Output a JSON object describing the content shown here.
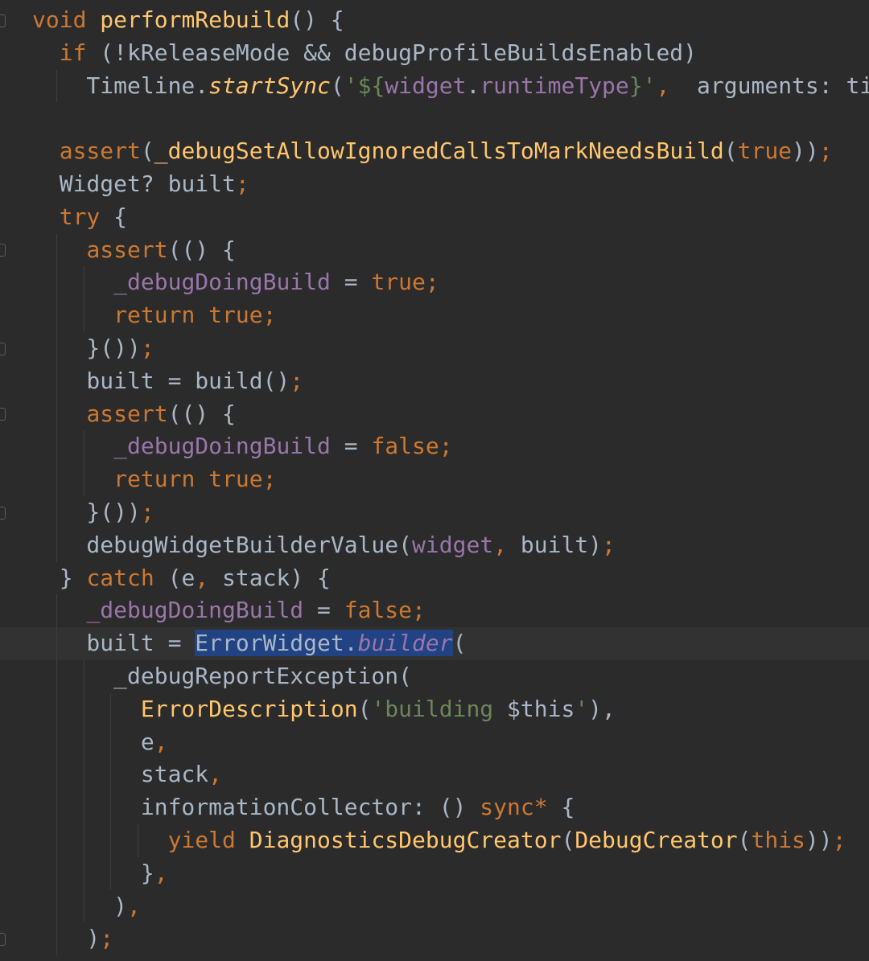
{
  "editor": {
    "lines": [
      [
        {
          "t": "void",
          "c": "kw"
        },
        {
          "t": " "
        },
        {
          "t": "performRebuild",
          "c": "fn"
        },
        {
          "t": "() {"
        }
      ],
      [
        {
          "t": "  "
        },
        {
          "t": "if",
          "c": "kw"
        },
        {
          "t": " (!kReleaseMode && debugProfileBuildsEnabled)"
        }
      ],
      [
        {
          "t": "    Timeline."
        },
        {
          "t": "startSync",
          "c": "fi"
        },
        {
          "t": "("
        },
        {
          "t": "'${",
          "c": "str"
        },
        {
          "t": "widget",
          "c": "fld"
        },
        {
          "t": "."
        },
        {
          "t": "runtimeType",
          "c": "fld"
        },
        {
          "t": "}'",
          "c": "str"
        },
        {
          "t": ",",
          "c": "kw"
        },
        {
          "t": "  arguments: tim"
        }
      ],
      [
        {
          "t": ""
        }
      ],
      [
        {
          "t": "  "
        },
        {
          "t": "assert",
          "c": "kw"
        },
        {
          "t": "("
        },
        {
          "t": "_debugSetAllowIgnoredCallsToMarkNeedsBuild",
          "c": "fn"
        },
        {
          "t": "("
        },
        {
          "t": "true",
          "c": "kw"
        },
        {
          "t": "))"
        },
        {
          "t": ";",
          "c": "kw"
        }
      ],
      [
        {
          "t": "  Widget? built"
        },
        {
          "t": ";",
          "c": "kw"
        }
      ],
      [
        {
          "t": "  "
        },
        {
          "t": "try",
          "c": "kw"
        },
        {
          "t": " {"
        }
      ],
      [
        {
          "t": "    "
        },
        {
          "t": "assert",
          "c": "kw"
        },
        {
          "t": "(() {"
        }
      ],
      [
        {
          "t": "      "
        },
        {
          "t": "_debugDoingBuild",
          "c": "fld"
        },
        {
          "t": " = "
        },
        {
          "t": "true",
          "c": "kw"
        },
        {
          "t": ";",
          "c": "kw"
        }
      ],
      [
        {
          "t": "      "
        },
        {
          "t": "return",
          "c": "kw"
        },
        {
          "t": " "
        },
        {
          "t": "true",
          "c": "kw"
        },
        {
          "t": ";",
          "c": "kw"
        }
      ],
      [
        {
          "t": "    }())"
        },
        {
          "t": ";",
          "c": "kw"
        }
      ],
      [
        {
          "t": "    built = build()"
        },
        {
          "t": ";",
          "c": "kw"
        }
      ],
      [
        {
          "t": "    "
        },
        {
          "t": "assert",
          "c": "kw"
        },
        {
          "t": "(() {"
        }
      ],
      [
        {
          "t": "      "
        },
        {
          "t": "_debugDoingBuild",
          "c": "fld"
        },
        {
          "t": " = "
        },
        {
          "t": "false",
          "c": "kw"
        },
        {
          "t": ";",
          "c": "kw"
        }
      ],
      [
        {
          "t": "      "
        },
        {
          "t": "return",
          "c": "kw"
        },
        {
          "t": " "
        },
        {
          "t": "true",
          "c": "kw"
        },
        {
          "t": ";",
          "c": "kw"
        }
      ],
      [
        {
          "t": "    }())"
        },
        {
          "t": ";",
          "c": "kw"
        }
      ],
      [
        {
          "t": "    debugWidgetBuilderValue("
        },
        {
          "t": "widget",
          "c": "fld"
        },
        {
          "t": ",",
          "c": "kw"
        },
        {
          "t": " built)"
        },
        {
          "t": ";",
          "c": "kw"
        }
      ],
      [
        {
          "t": "  } "
        },
        {
          "t": "catch",
          "c": "kw"
        },
        {
          "t": " (e"
        },
        {
          "t": ",",
          "c": "kw"
        },
        {
          "t": " stack) {"
        }
      ],
      [
        {
          "t": "    "
        },
        {
          "t": "_debugDoingBuild",
          "c": "fld"
        },
        {
          "t": " = "
        },
        {
          "t": "false",
          "c": "kw"
        },
        {
          "t": ";",
          "c": "kw"
        }
      ],
      [
        {
          "t": "    built = "
        },
        {
          "t": "ErrorWidget.",
          "c": "sel"
        },
        {
          "t": "builder",
          "c": "sel mi"
        },
        {
          "t": "("
        }
      ],
      [
        {
          "t": "      _debugReportException("
        }
      ],
      [
        {
          "t": "        "
        },
        {
          "t": "ErrorDescription",
          "c": "fn"
        },
        {
          "t": "("
        },
        {
          "t": "'building ",
          "c": "str"
        },
        {
          "t": "$this"
        },
        {
          "t": "'",
          "c": "str"
        },
        {
          "t": "),"
        }
      ],
      [
        {
          "t": "        e"
        },
        {
          "t": ",",
          "c": "kw"
        }
      ],
      [
        {
          "t": "        stack"
        },
        {
          "t": ",",
          "c": "kw"
        }
      ],
      [
        {
          "t": "        informationCollector: () "
        },
        {
          "t": "sync*",
          "c": "kw"
        },
        {
          "t": " {"
        }
      ],
      [
        {
          "t": "          "
        },
        {
          "t": "yield",
          "c": "kw"
        },
        {
          "t": " "
        },
        {
          "t": "DiagnosticsDebugCreator",
          "c": "fn"
        },
        {
          "t": "("
        },
        {
          "t": "DebugCreator",
          "c": "fn"
        },
        {
          "t": "("
        },
        {
          "t": "this",
          "c": "kw"
        },
        {
          "t": "))"
        },
        {
          "t": ";",
          "c": "kw"
        }
      ],
      [
        {
          "t": "        }"
        },
        {
          "t": ",",
          "c": "kw"
        }
      ],
      [
        {
          "t": "      )"
        },
        {
          "t": ",",
          "c": "kw"
        }
      ],
      [
        {
          "t": "    )"
        },
        {
          "t": ";",
          "c": "kw"
        }
      ]
    ],
    "current_line": 19,
    "colors": {
      "background": "#2b2b2b",
      "keyword": "#cc7832",
      "function": "#ffc66d",
      "field": "#9876aa",
      "string": "#6a8759",
      "default": "#a9b7c6",
      "selection": "#214283",
      "bulb": "#f5b62d"
    },
    "icons": {
      "intention_bulb": "lightbulb-icon"
    }
  }
}
